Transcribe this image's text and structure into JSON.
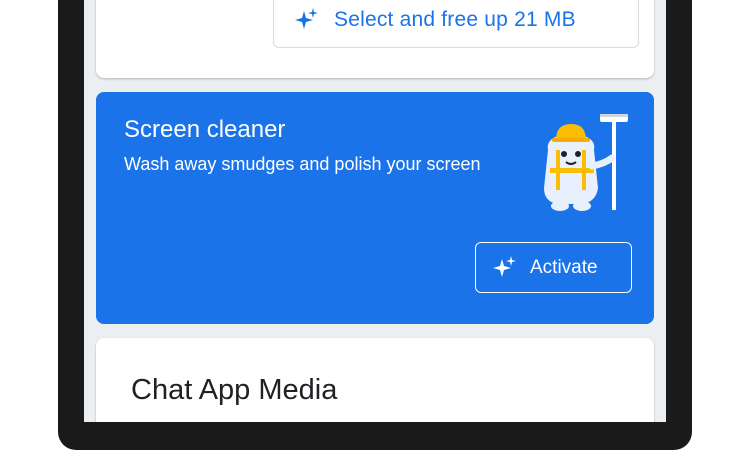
{
  "top_card": {
    "free_up_button_label": "Select and free up 21 MB"
  },
  "cleaner_card": {
    "title": "Screen cleaner",
    "description": "Wash away smudges and polish your screen",
    "activate_label": "Activate"
  },
  "chat_card": {
    "title": "Chat App Media"
  },
  "icons": {
    "sparkle": "sparkle-icon",
    "mascot": "cleaner-mascot-illustration"
  },
  "colors": {
    "accent_blue": "#1a73e8",
    "card_background": "#ffffff",
    "screen_background": "#eceff1",
    "text_dark": "#202124"
  }
}
